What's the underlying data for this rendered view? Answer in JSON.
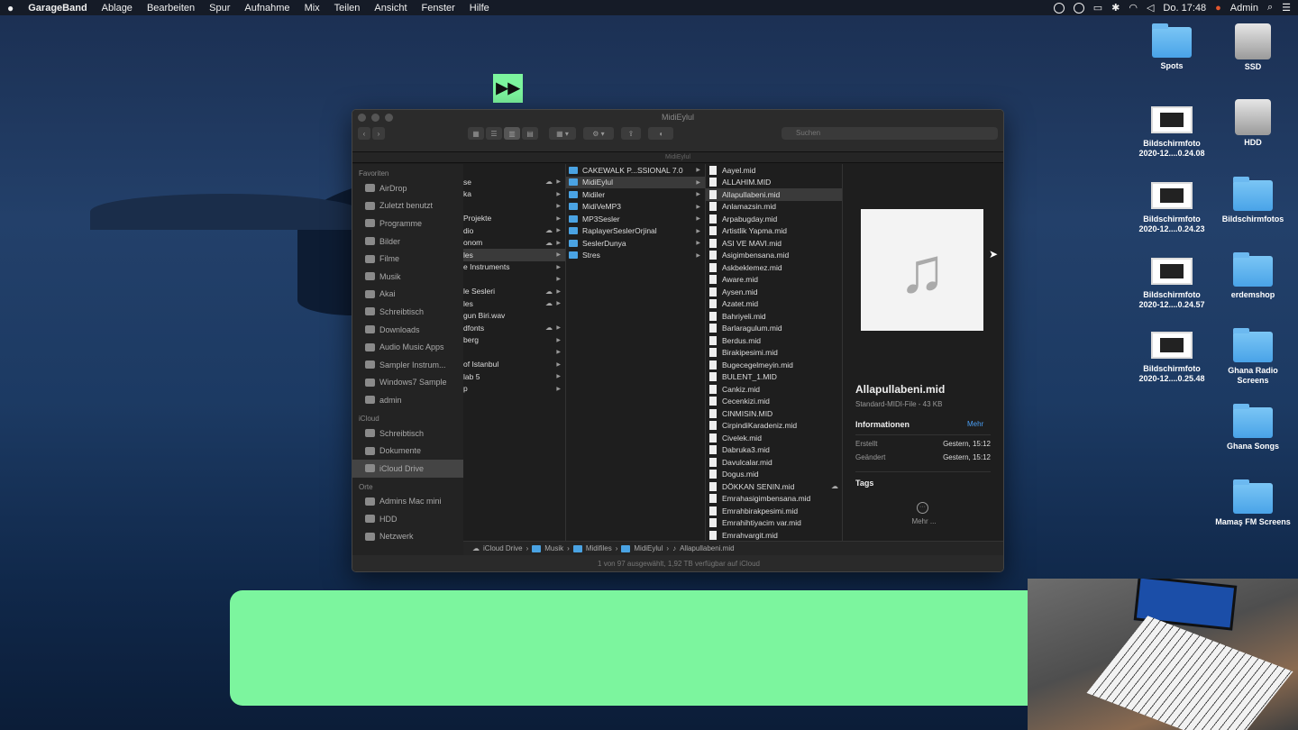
{
  "menubar": {
    "apple": "",
    "items": [
      "GarageBand",
      "Ablage",
      "Bearbeiten",
      "Spur",
      "Aufnahme",
      "Mix",
      "Teilen",
      "Ansicht",
      "Fenster",
      "Hilfe"
    ],
    "clock": "Do. 17:48",
    "user": "Admin"
  },
  "ff_button": {
    "label": "▶▶"
  },
  "desktop": [
    {
      "label": "Spots",
      "kind": "folder"
    },
    {
      "label": "SSD",
      "kind": "drive"
    },
    {
      "label": "Bildschirmfoto 2020-12....0.24.08",
      "kind": "shot"
    },
    {
      "label": "HDD",
      "kind": "drive"
    },
    {
      "label": "Bildschirmfoto 2020-12....0.24.23",
      "kind": "shot"
    },
    {
      "label": "Bildschirmfotos",
      "kind": "folder"
    },
    {
      "label": "Bildschirmfoto 2020-12....0.24.57",
      "kind": "shot"
    },
    {
      "label": "erdemshop",
      "kind": "folder"
    },
    {
      "label": "Bildschirmfoto 2020-12....0.25.48",
      "kind": "shot"
    },
    {
      "label": "Ghana Radio Screens",
      "kind": "folder"
    },
    {
      "label": "Ghana Songs",
      "kind": "folder"
    },
    {
      "label": "Mamaş FM Screens",
      "kind": "folder"
    }
  ],
  "finder": {
    "title": "MidiEylul",
    "path_title": "MidiEylul",
    "search_placeholder": "Suchen",
    "sidebar": {
      "favorites_title": "Favoriten",
      "favorites": [
        "AirDrop",
        "Zuletzt benutzt",
        "Programme",
        "Bilder",
        "Filme",
        "Musik",
        "Akai",
        "Schreibtisch",
        "Downloads",
        "Audio Music Apps",
        "Sampler Instrum...",
        "Windows7 Sample",
        "admin"
      ],
      "icloud_title": "iCloud",
      "icloud": [
        "Schreibtisch",
        "Dokumente",
        "iCloud Drive"
      ],
      "places_title": "Orte",
      "places": [
        "Admins Mac mini",
        "HDD",
        "Netzwerk"
      ]
    },
    "col1": [
      "se",
      "ka",
      "",
      "Projekte",
      "dio",
      "onom",
      "les",
      "e Instruments",
      "",
      "le Sesleri",
      "les",
      "gun Biri.wav",
      "dfonts",
      "berg",
      "",
      "of Istanbul",
      "lab 5",
      "p"
    ],
    "col2": [
      "CAKEWALK P...SSIONAL 7.0",
      "MidiEylul",
      "Midiler",
      "MidiVeMP3",
      "MP3Sesler",
      "RaplayerSeslerOrjinal",
      "SeslerDunya",
      "Stres"
    ],
    "col3": [
      "Aayel.mid",
      "ALLAHIM.MID",
      "Allapullabeni.mid",
      "Anlamazsin.mid",
      "Arpabugday.mid",
      "Artistlik Yapma.mid",
      "ASI VE MAVI.mid",
      "Asigimbensana.mid",
      "Askbeklemez.mid",
      "Aware.mid",
      "Aysen.mid",
      "Azatet.mid",
      "Bahriyeli.mid",
      "Barlaragulum.mid",
      "Berdus.mid",
      "Birakipesimi.mid",
      "Bugecegelmeyin.mid",
      "BULENT_1.MID",
      "Cankiz.mid",
      "Cecenkizi.mid",
      "CINMISIN.MID",
      "CirpindiKaradeniz.mid",
      "Civelek.mid",
      "Dabruka3.mid",
      "Davulcalar.mid",
      "Dogus.mid",
      "DÖKKAN SENIN.mid",
      "Emrahasigimbensana.mid",
      "Emrahbirakpesimi.mid",
      "Emrahihtiyacim var.mid",
      "Emrahvargit.mid"
    ],
    "preview": {
      "name": "Allapullabeni.mid",
      "kind": "Standard-MIDI-File - 43 KB",
      "info": "Informationen",
      "more": "Mehr",
      "created_label": "Erstellt",
      "created": "Gestern, 15:12",
      "modified_label": "Geändert",
      "modified": "Gestern, 15:12",
      "tags": "Tags",
      "more_btn": "Mehr ..."
    },
    "pathbar": [
      "iCloud Drive",
      "Musik",
      "Midifiles",
      "MidiEylul",
      "Allapullabeni.mid"
    ],
    "status": "1 von 97 ausgewählt, 1,92 TB verfügbar auf iCloud"
  }
}
